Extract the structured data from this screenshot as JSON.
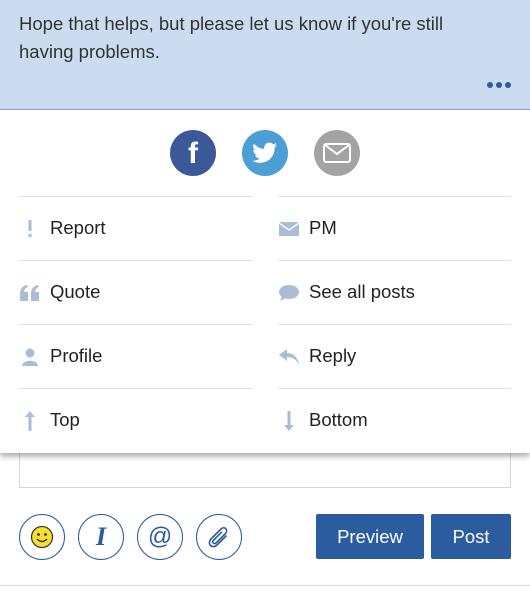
{
  "message": {
    "line1": "Hope that helps, but please let us know if you're still",
    "line2": "having problems."
  },
  "share": {
    "facebook": "f"
  },
  "menu": {
    "items": [
      {
        "label": "Report",
        "icon": "exclamation-icon"
      },
      {
        "label": "PM",
        "icon": "envelope-icon"
      },
      {
        "label": "Quote",
        "icon": "quote-icon"
      },
      {
        "label": "See all posts",
        "icon": "speech-bubble-icon"
      },
      {
        "label": "Profile",
        "icon": "person-icon"
      },
      {
        "label": "Reply",
        "icon": "reply-arrow-icon"
      },
      {
        "label": "Top",
        "icon": "arrow-up-icon"
      },
      {
        "label": "Bottom",
        "icon": "arrow-down-icon"
      }
    ]
  },
  "composer": {
    "preview_label": "Preview",
    "post_label": "Post",
    "italic_glyph": "I",
    "mention_glyph": "@"
  },
  "colors": {
    "accent": "#2b5ca0",
    "message_bg": "#cbdcf1",
    "facebook": "#3b5998",
    "twitter": "#4b9fd5",
    "email": "#a3a3a3",
    "menu_icon": "#a9bdd6"
  }
}
